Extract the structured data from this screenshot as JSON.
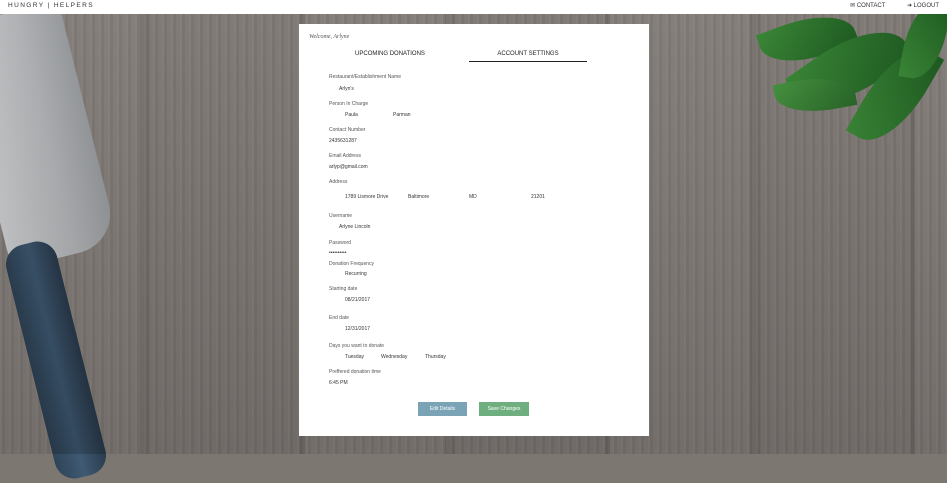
{
  "topbar": {
    "brand": "HUNGRY | HELPERS",
    "contact": "✉ CONTACT",
    "logout": "➜ LOGOUT"
  },
  "card": {
    "welcome": "Welcome, Arlyne",
    "tabs": [
      "UPCOMING DONATIONS",
      "ACCOUNT SETTINGS"
    ],
    "form": {
      "restaurant_label": "Restaurant/Establishment Name",
      "restaurant_value": "Arlyn's",
      "person_label": "Person In Charge",
      "person_first": "Paula",
      "person_last": "Parman",
      "contact_label": "Contact Number",
      "contact_value": "2435631287",
      "email_label": "Email Address",
      "email_value": "arlyp@gmail.com",
      "address_label": "Address",
      "address_street": "1789 Lismore Drive",
      "address_city": "Baltimore",
      "address_state": "MD",
      "address_zip": "21201",
      "username_label": "Username",
      "username_value": "Arlyne Lincoln",
      "password_label": "Password",
      "password_value": "••••••••••",
      "frequency_label": "Donation Frequency",
      "frequency_value": "Recurring",
      "start_label": "Starting date",
      "start_value": "08/21/2017",
      "end_label": "End date",
      "end_value": "12/31/2017",
      "days_label": "Days you want to donate",
      "days": [
        "Tuesday",
        "Wednesday",
        "Thursday"
      ],
      "time_label": "Preffered donation time",
      "time_value": "6:45 PM"
    },
    "buttons": {
      "edit": "Edit Details",
      "save": "Save Changes"
    }
  },
  "colors": {
    "edit_button": "#7aa3b6",
    "save_button": "#6fae7e"
  }
}
